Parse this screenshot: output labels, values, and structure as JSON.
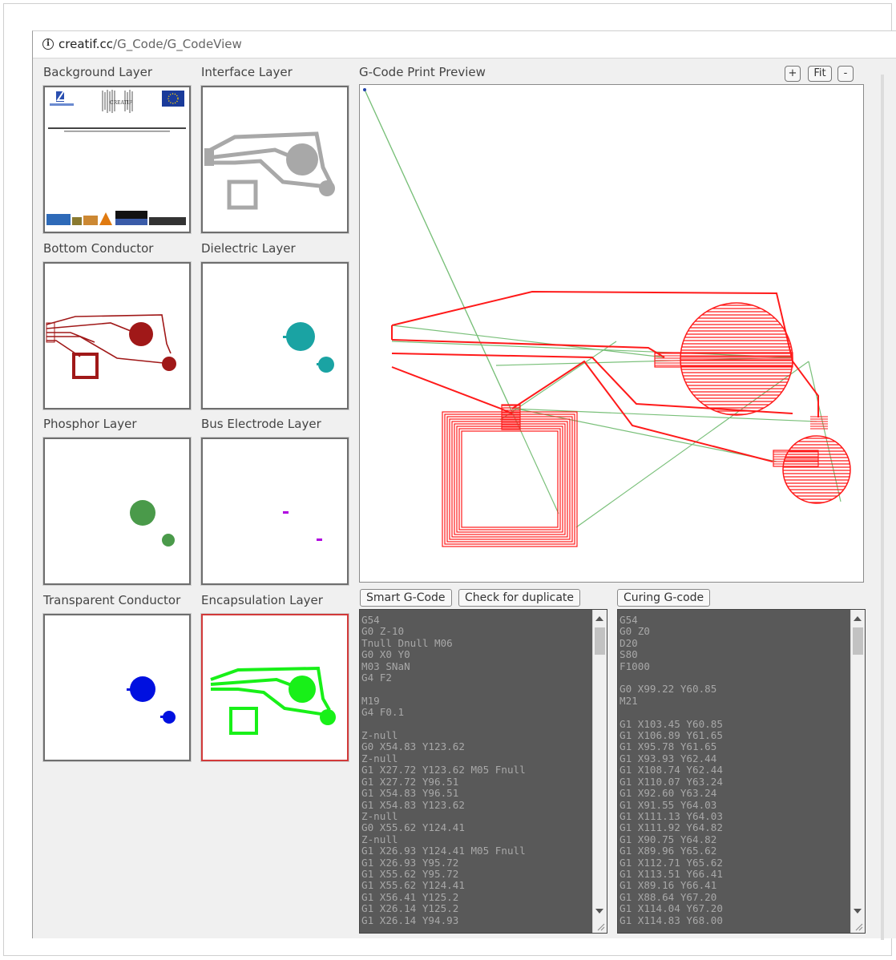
{
  "browser": {
    "url_host": "creatif.cc",
    "url_path": "/G_Code/G_CodeView"
  },
  "layers": [
    {
      "label": "Background Layer"
    },
    {
      "label": "Interface Layer"
    },
    {
      "label": "Bottom Conductor"
    },
    {
      "label": "Dielectric Layer"
    },
    {
      "label": "Phosphor Layer"
    },
    {
      "label": "Bus Electrode Layer"
    },
    {
      "label": "Transparent Conductor"
    },
    {
      "label": "Encapsulation Layer"
    }
  ],
  "preview": {
    "title": "G-Code Print Preview",
    "zoom_in": "+",
    "fit": "Fit",
    "zoom_out": "-"
  },
  "buttons": {
    "smart": "Smart G-Code",
    "duplicate": "Check for duplicate",
    "curing": "Curing G-code"
  },
  "colors": {
    "bottom_conductor": "#a01818",
    "dielectric": "#1aa3a3",
    "phosphor": "#4a9a4a",
    "bus_electrode": "#b000e0",
    "transparent_conductor": "#0010e0",
    "encapsulation": "#18f018",
    "interface": "#a8a8a8",
    "toolpath": "#ff1a1a",
    "travel": "#7ac07a"
  },
  "smart_gcode": "G54\nG0 Z-10\nTnull Dnull M06\nG0 X0 Y0\nM03 SNaN\nG4 F2\n\nM19\nG4 F0.1\n\nZ-null\nG0 X54.83 Y123.62\nZ-null\nG1 X27.72 Y123.62 M05 Fnull\nG1 X27.72 Y96.51\nG1 X54.83 Y96.51\nG1 X54.83 Y123.62\nZ-null\nG0 X55.62 Y124.41\nZ-null\nG1 X26.93 Y124.41 M05 Fnull\nG1 X26.93 Y95.72\nG1 X55.62 Y95.72\nG1 X55.62 Y124.41\nG1 X56.41 Y125.2\nG1 X26.14 Y125.2\nG1 X26.14 Y94.93",
  "curing_gcode": "G54\nG0 Z0\nD20\nS80\nF1000\n\nG0 X99.22 Y60.85\nM21\n\nG1 X103.45 Y60.85\nG1 X106.89 Y61.65\nG1 X95.78 Y61.65\nG1 X93.93 Y62.44\nG1 X108.74 Y62.44\nG1 X110.07 Y63.24\nG1 X92.60 Y63.24\nG1 X91.55 Y64.03\nG1 X111.13 Y64.03\nG1 X111.92 Y64.82\nG1 X90.75 Y64.82\nG1 X89.96 Y65.62\nG1 X112.71 Y65.62\nG1 X113.51 Y66.41\nG1 X89.16 Y66.41\nG1 X88.64 Y67.20\nG1 X114.04 Y67.20\nG1 X114.83 Y68.00"
}
